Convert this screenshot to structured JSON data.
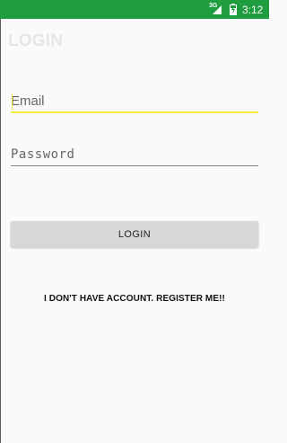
{
  "status_bar": {
    "network": "3G",
    "time": "3:12",
    "background_color": "#1e9d3f",
    "icons": [
      "cellular-signal-icon",
      "battery-charging-icon"
    ]
  },
  "app": {
    "title": "LOGIN"
  },
  "form": {
    "email_placeholder": "Email",
    "email_value": "",
    "password_placeholder": "Password",
    "password_value": "",
    "login_label": "LOGIN",
    "register_label": "I DON'T HAVE ACCOUNT. REGISTER ME!!"
  },
  "colors": {
    "accent": "#f4ec3a",
    "button_bg": "#d8d8d8",
    "title_color": "#e6e6e6"
  }
}
